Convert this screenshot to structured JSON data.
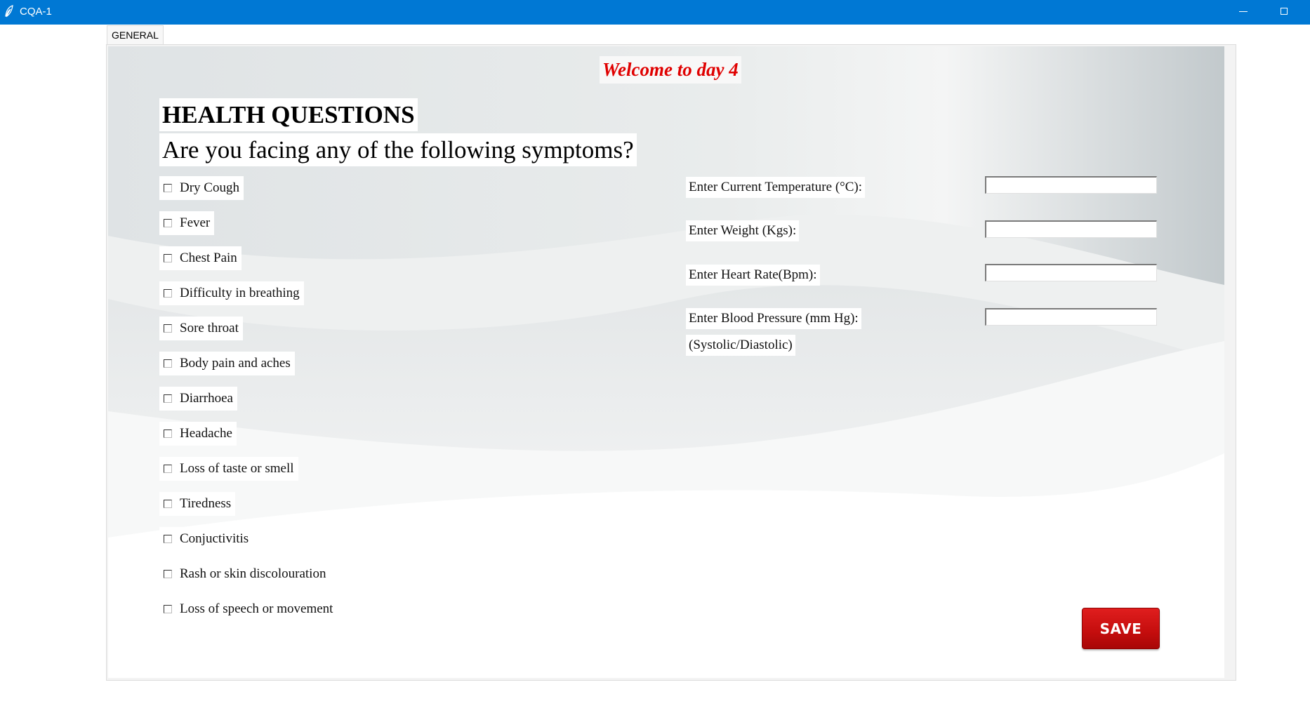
{
  "window": {
    "title": "CQA-1",
    "icon": "feather-icon"
  },
  "tabs": [
    {
      "label": "GENERAL"
    }
  ],
  "form": {
    "welcome": "Welcome to day 4",
    "heading": "HEALTH QUESTIONS",
    "subheading": "Are you facing any of the following symptoms?",
    "symptoms": [
      {
        "label": "Dry Cough",
        "checked": false
      },
      {
        "label": "Fever",
        "checked": false
      },
      {
        "label": "Chest Pain",
        "checked": false
      },
      {
        "label": "Difficulty in breathing",
        "checked": false
      },
      {
        "label": "Sore throat",
        "checked": false
      },
      {
        "label": "Body pain and aches",
        "checked": false
      },
      {
        "label": "Diarrhoea",
        "checked": false
      },
      {
        "label": "Headache",
        "checked": false
      },
      {
        "label": "Loss of taste or smell",
        "checked": false
      },
      {
        "label": "Tiredness",
        "checked": false
      },
      {
        "label": "Conjuctivitis",
        "checked": false
      },
      {
        "label": "Rash or skin discolouration",
        "checked": false
      },
      {
        "label": "Loss of speech or movement",
        "checked": false
      }
    ],
    "fields": [
      {
        "label": "Enter Current Temperature (°C):",
        "value": ""
      },
      {
        "label": "Enter Weight (Kgs):",
        "value": ""
      },
      {
        "label": "Enter Heart Rate(Bpm):",
        "value": ""
      },
      {
        "label": "Enter Blood Pressure (mm Hg):",
        "value": ""
      }
    ],
    "bp_hint": "(Systolic/Diastolic)",
    "save_label": "SAVE"
  },
  "colors": {
    "titlebar": "#0078d4",
    "welcome_text": "#e00000",
    "save_button": "#c40d0d"
  }
}
